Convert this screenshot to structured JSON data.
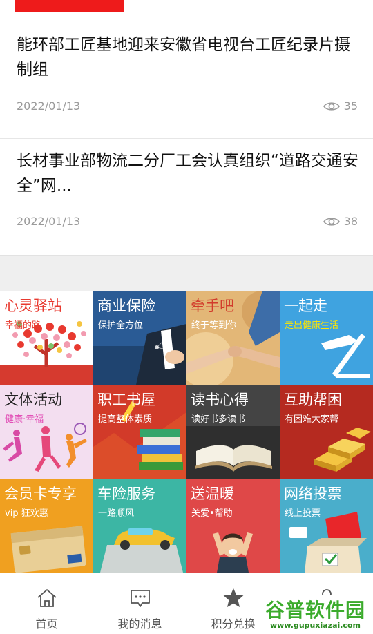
{
  "news": [
    {
      "title": "能环部工匠基地迎来安徽省电视台工匠纪录片摄制组",
      "date": "2022/01/13",
      "views": "35"
    },
    {
      "title": "长材事业部物流二分厂工会认真组织“道路交通安全”网...",
      "date": "2022/01/13",
      "views": "38"
    }
  ],
  "tiles": [
    {
      "title": "心灵驿站",
      "sub": "幸福的路",
      "bg": "#ffffff",
      "title_color": "#e8392f",
      "sub_color": "#e8392f"
    },
    {
      "title": "商业保险",
      "sub": "保护全方位",
      "bg": "#2e5f9a",
      "title_color": "#ffffff",
      "sub_color": "#ffffff"
    },
    {
      "title": "牵手吧",
      "sub": "终于等到你",
      "bg": "#e0b478",
      "title_color": "#d23b2b",
      "sub_color": "#ffffff"
    },
    {
      "title": "一起走",
      "sub": "走出健康生活",
      "bg": "#45a6e3",
      "title_color": "#ffffff",
      "sub_color": "#ffe600"
    },
    {
      "title": "文体活动",
      "sub": "健康·幸福",
      "bg": "#f3dff0",
      "title_color": "#222222",
      "sub_color": "#e040b0"
    },
    {
      "title": "职工书屋",
      "sub": "提高整体素质",
      "bg": "#d33b2a",
      "title_color": "#ffffff",
      "sub_color": "#ffffff"
    },
    {
      "title": "读书心得",
      "sub": "读好书多读书",
      "bg": "#3b3b3b",
      "title_color": "#ffffff",
      "sub_color": "#ffffff"
    },
    {
      "title": "互助帮困",
      "sub": "有困难大家帮",
      "bg": "#b8291f",
      "title_color": "#ffffff",
      "sub_color": "#ffffff"
    },
    {
      "title": "会员卡专享",
      "sub": "vip 狂欢惠",
      "bg": "#f0a020",
      "title_color": "#ffffff",
      "sub_color": "#ffffff"
    },
    {
      "title": "车险服务",
      "sub": "一路顺风",
      "bg": "#3fb8a6",
      "title_color": "#ffffff",
      "sub_color": "#ffffff"
    },
    {
      "title": "送温暖",
      "sub": "关爱•帮助",
      "bg": "#e04b4b",
      "title_color": "#ffffff",
      "sub_color": "#ffffff"
    },
    {
      "title": "网络投票",
      "sub": "线上投票",
      "bg": "#4ab0cc",
      "title_color": "#ffffff",
      "sub_color": "#ffffff"
    }
  ],
  "tabs": [
    {
      "label": "首页",
      "icon": "home-icon"
    },
    {
      "label": "我的消息",
      "icon": "message-icon"
    },
    {
      "label": "积分兑换",
      "icon": "star-icon"
    },
    {
      "label": "我的",
      "icon": "user-icon"
    }
  ],
  "watermark": {
    "text": "谷普软件园",
    "url": "www.gupuxiazai.com"
  },
  "colors": {
    "accent": "#ee1b1b",
    "meta": "#9a9a9a"
  }
}
